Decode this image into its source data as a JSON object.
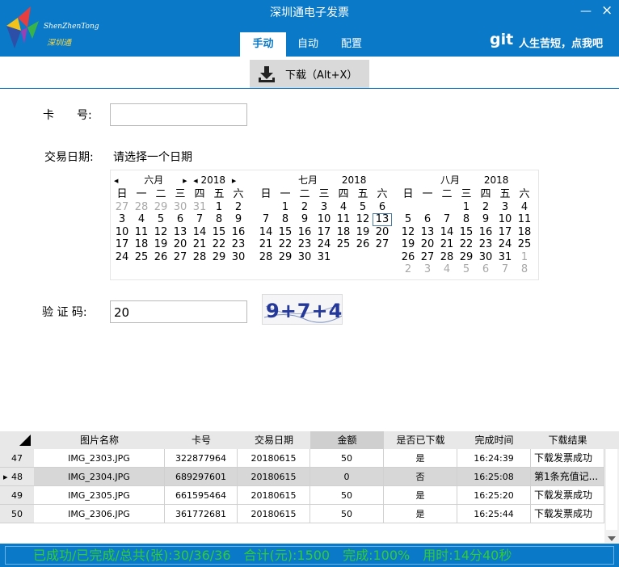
{
  "window": {
    "title": "深圳通电子发票",
    "minimize": "—",
    "close": "×"
  },
  "logo": {
    "text_en": "ShenZhenTong",
    "text_cn": "深圳通"
  },
  "tabs": [
    {
      "label": "手动",
      "active": true
    },
    {
      "label": "自动",
      "active": false
    },
    {
      "label": "配置",
      "active": false
    }
  ],
  "git": {
    "logo": "git",
    "slogan": "人生苦短，点我吧"
  },
  "toolbar": {
    "download_label": "下载（Alt+X）",
    "download_icon": "download-icon"
  },
  "form": {
    "card_label": "卡　　号:",
    "card_value": "",
    "date_label": "交易日期:",
    "date_value": "请选择一个日期",
    "captcha_label": "验 证 码:",
    "captcha_value": "20",
    "captcha_image_text": "9+7+4"
  },
  "calendar": {
    "weekdays": [
      "日",
      "一",
      "二",
      "三",
      "四",
      "五",
      "六"
    ],
    "months": [
      {
        "month": "六月",
        "year": "2018",
        "days": [
          "27",
          "28",
          "29",
          "30",
          "31",
          "1",
          "2",
          "3",
          "4",
          "5",
          "6",
          "7",
          "8",
          "9",
          "10",
          "11",
          "12",
          "13",
          "14",
          "15",
          "16",
          "17",
          "18",
          "19",
          "20",
          "21",
          "22",
          "23",
          "24",
          "25",
          "26",
          "27",
          "28",
          "29",
          "30"
        ],
        "dim": [
          0,
          1,
          2,
          3,
          4
        ]
      },
      {
        "month": "七月",
        "year": "2018",
        "days": [
          "",
          "1",
          "2",
          "3",
          "4",
          "5",
          "6",
          "7",
          "8",
          "9",
          "10",
          "11",
          "12",
          "13",
          "14",
          "15",
          "16",
          "17",
          "18",
          "19",
          "20",
          "21",
          "22",
          "23",
          "24",
          "25",
          "26",
          "27",
          "28",
          "29",
          "30",
          "31"
        ],
        "dim": [],
        "today": "13"
      },
      {
        "month": "八月",
        "year": "2018",
        "days": [
          "",
          "",
          "",
          "1",
          "2",
          "3",
          "4",
          "5",
          "6",
          "7",
          "8",
          "9",
          "10",
          "11",
          "12",
          "13",
          "14",
          "15",
          "16",
          "17",
          "18",
          "19",
          "20",
          "21",
          "22",
          "23",
          "24",
          "25",
          "26",
          "27",
          "28",
          "29",
          "30",
          "31",
          "1",
          "2",
          "3",
          "4",
          "5",
          "6",
          "7",
          "8"
        ],
        "dim": [
          34,
          35,
          36,
          37,
          38,
          39,
          40,
          41
        ]
      }
    ]
  },
  "table": {
    "columns": [
      "图片名称",
      "卡号",
      "交易日期",
      "金额",
      "是否已下载",
      "完成时间",
      "下载结果"
    ],
    "rows": [
      {
        "index": "47",
        "selected": false,
        "cells": [
          "IMG_2303.JPG",
          "322877964",
          "20180615",
          "50",
          "是",
          "16:24:39",
          "下载发票成功"
        ]
      },
      {
        "index": "48",
        "selected": true,
        "cells": [
          "IMG_2304.JPG",
          "689297601",
          "20180615",
          "0",
          "否",
          "16:25:08",
          "第1条充值记..."
        ]
      },
      {
        "index": "49",
        "selected": false,
        "cells": [
          "IMG_2305.JPG",
          "661595464",
          "20180615",
          "50",
          "是",
          "16:25:20",
          "下载发票成功"
        ]
      },
      {
        "index": "50",
        "selected": false,
        "cells": [
          "IMG_2306.JPG",
          "361772681",
          "20180615",
          "50",
          "是",
          "16:25:44",
          "下载发票成功"
        ]
      }
    ]
  },
  "status": {
    "text": "已成功/已完成/总共(张):30/36/36　合计(元):1500　完成:100%　用时:14分40秒"
  },
  "colors": {
    "primary": "#0a7ac8",
    "status_text": "#32cd32"
  }
}
